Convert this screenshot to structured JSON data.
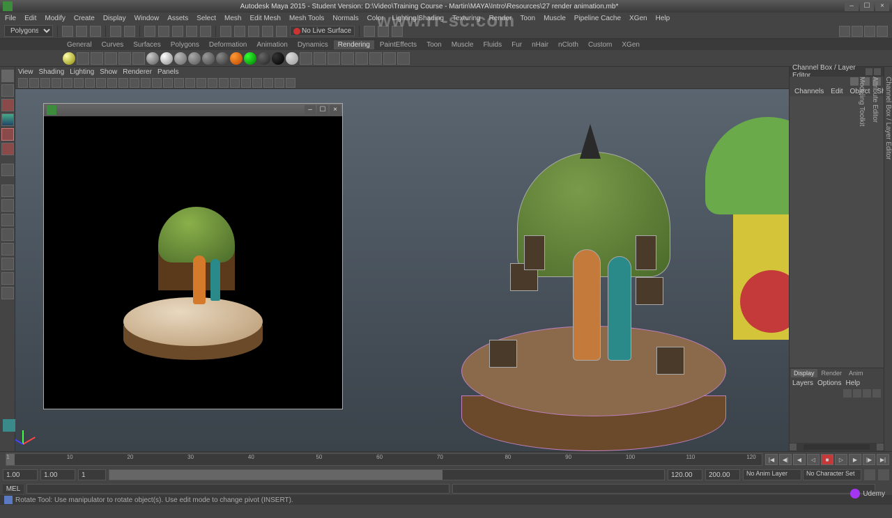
{
  "titlebar": {
    "title": "Autodesk Maya 2015 - Student Version: D:\\Video\\Training Course - Martin\\MAYA\\Intro\\Resources\\27 render animation.mb*"
  },
  "menubar": [
    "File",
    "Edit",
    "Modify",
    "Create",
    "Display",
    "Window",
    "Assets",
    "Select",
    "Mesh",
    "Edit Mesh",
    "Mesh Tools",
    "Normals",
    "Color",
    "Lighting/Shading",
    "Texturing",
    "Render",
    "Toon",
    "Muscle",
    "Pipeline Cache",
    "XGen",
    "Help"
  ],
  "status_select": "Polygons",
  "nolive_label": "No Live Surface",
  "shelf_tabs": [
    "General",
    "Curves",
    "Surfaces",
    "Polygons",
    "Deformation",
    "Animation",
    "Dynamics",
    "Rendering",
    "PaintEffects",
    "Toon",
    "Muscle",
    "Fluids",
    "Fur",
    "nHair",
    "nCloth",
    "Custom",
    "XGen"
  ],
  "shelf_active": 7,
  "panel_menu": [
    "View",
    "Shading",
    "Lighting",
    "Show",
    "Renderer",
    "Panels"
  ],
  "channel_box": {
    "title": "Channel Box / Layer Editor",
    "tabs": [
      "Channels",
      "Edit",
      "Object",
      "Show"
    ]
  },
  "layers": {
    "tabs": [
      "Display",
      "Render",
      "Anim"
    ],
    "active": 0,
    "menu": [
      "Layers",
      "Options",
      "Help"
    ]
  },
  "timeline": {
    "start": "1.00",
    "start2": "1.00",
    "current": "1",
    "end": "120.00",
    "end2": "200.00",
    "ticks": [
      1,
      10,
      20,
      30,
      40,
      50,
      60,
      70,
      80,
      90,
      100,
      110,
      120
    ],
    "anim_layer": "No Anim Layer",
    "char_set": "No Character Set"
  },
  "cmdline": {
    "label": "MEL"
  },
  "helpline": "Rotate Tool: Use manipulator to rotate object(s). Use edit mode to change pivot (INSERT).",
  "watermark": "www.rr-sc.com",
  "udemy": "Udemy",
  "side_tabs": [
    "Channel Box / Layer Editor",
    "Attribute Editor",
    "Modeling Toolkit"
  ]
}
